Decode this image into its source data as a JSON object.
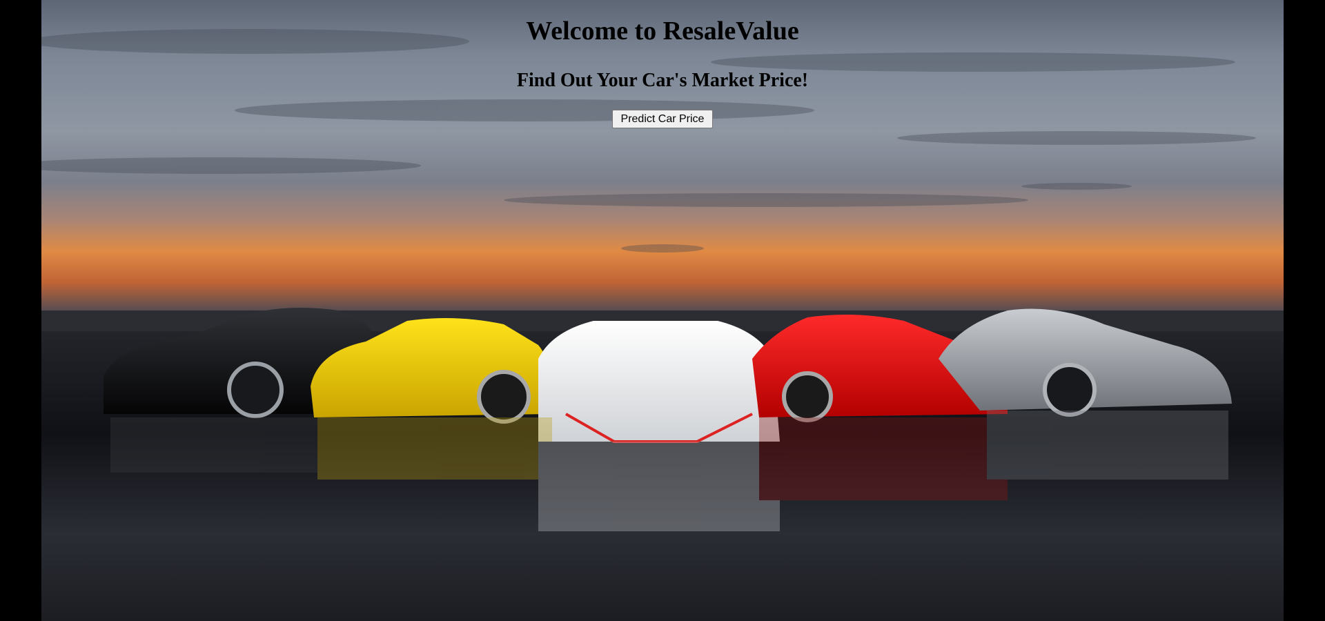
{
  "hero": {
    "title": "Welcome to ResaleValue",
    "subtitle": "Find Out Your Car's Market Price!",
    "predict_button_label": "Predict Car Price"
  },
  "colors": {
    "side_bars": "#000000",
    "text": "#000000",
    "button_bg": "#f0f0f0",
    "button_border": "#767676"
  }
}
